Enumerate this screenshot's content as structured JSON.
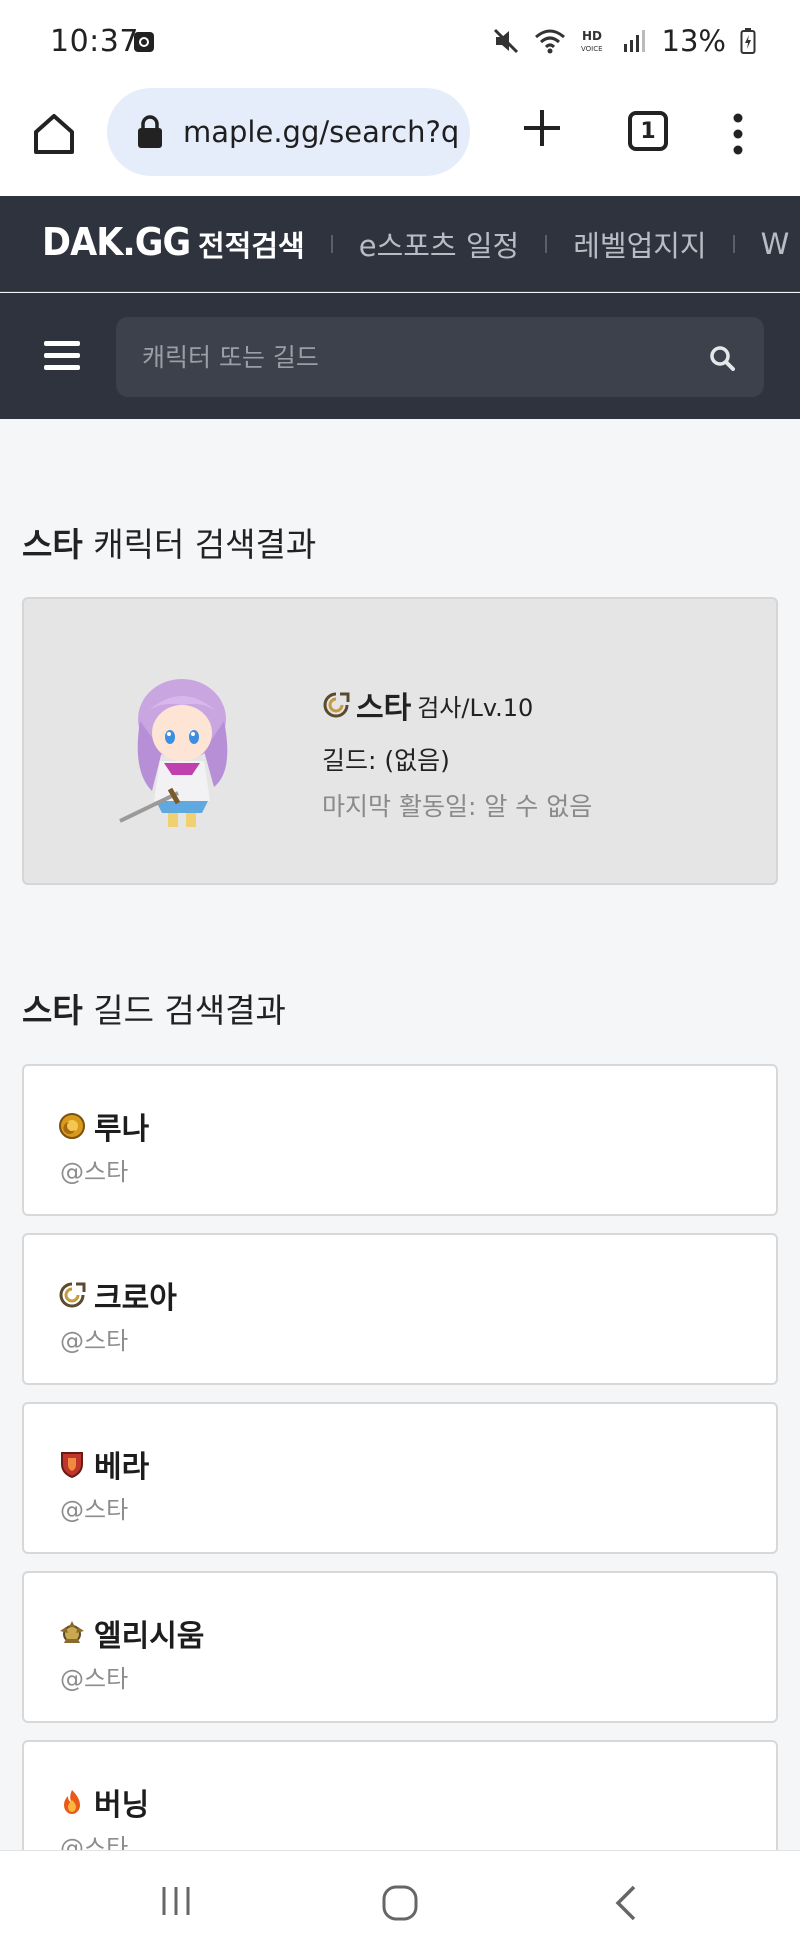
{
  "status_bar": {
    "time": "10:37",
    "battery": "13%",
    "icons": [
      "mute-icon",
      "wifi-icon",
      "hd-voice-icon",
      "signal-icon",
      "battery-icon"
    ]
  },
  "browser": {
    "url": "maple.gg/search?q",
    "tab_count": "1"
  },
  "site": {
    "logo": "DAK.GG",
    "nav": [
      {
        "label": "전적검색",
        "active": true
      },
      {
        "label": "e스포츠 일정",
        "active": false
      },
      {
        "label": "레벨업지지",
        "active": false
      },
      {
        "label": "W",
        "active": false
      }
    ],
    "search_placeholder": "캐릭터 또는 길드"
  },
  "character_section": {
    "query": "스타",
    "title_suffix": " 캐릭터 검색결과",
    "character": {
      "world_icon": "croa-world-icon",
      "name": "스타",
      "job_level": "검사/Lv.10",
      "guild": "길드: (없음)",
      "last_active": "마지막 활동일: 알 수 없음"
    }
  },
  "guild_section": {
    "query": "스타",
    "title_suffix": " 길드 검색결과",
    "guilds": [
      {
        "world": "루나",
        "name": "@스타",
        "icon": "luna-world-icon",
        "color": "#d99a1c"
      },
      {
        "world": "크로아",
        "name": "@스타",
        "icon": "croa-world-icon",
        "color": "#8a6a3c"
      },
      {
        "world": "베라",
        "name": "@스타",
        "icon": "bera-world-icon",
        "color": "#c0352b"
      },
      {
        "world": "엘리시움",
        "name": "@스타",
        "icon": "elysium-world-icon",
        "color": "#b08a3a"
      },
      {
        "world": "버닝",
        "name": "@스타",
        "icon": "burning-world-icon",
        "color": "#e8591a"
      }
    ]
  },
  "colors": {
    "nav_bg": "#2e333d",
    "url_bg": "#e5edfb",
    "page_bg": "#f5f6f8"
  }
}
